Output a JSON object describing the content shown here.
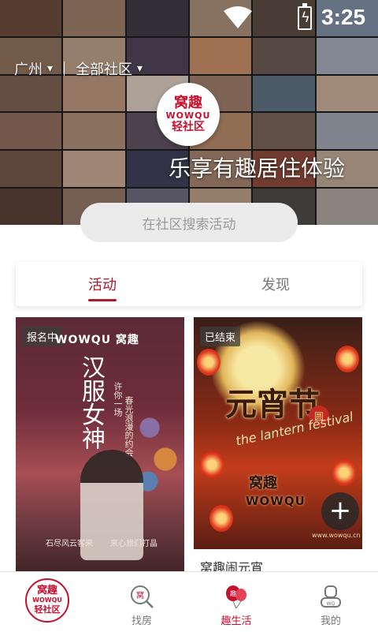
{
  "status_bar": {
    "time": "3:25"
  },
  "header": {
    "city": "广州",
    "community": "全部社区",
    "logo": {
      "line1": "窝趣",
      "line2": "WOWQU",
      "line3": "轻社区"
    },
    "slogan": "乐享有趣居住体验"
  },
  "search": {
    "placeholder": "在社区搜索活动"
  },
  "tabs": [
    {
      "label": "活动",
      "active": true
    },
    {
      "label": "发现",
      "active": false
    }
  ],
  "cards": [
    {
      "badge": "报名中",
      "poster_brand": "WOWQU 窝趣",
      "poster_title": "汉服女神",
      "poster_sub1": "许你一场",
      "poster_sub2": "春光浪漫的约会",
      "poster_foot1": "石尽风云客来",
      "poster_foot2": "来心旅们打晶"
    },
    {
      "badge": "已结束",
      "poster_title": "元宵节",
      "poster_en": "the lantern festival",
      "poster_circle": "圆",
      "poster_brand": "窝趣",
      "poster_wowqu": "WOWQU",
      "poster_url": "www.wowqu.cn",
      "title": "窝趣闹元宵"
    }
  ],
  "bottom_nav": [
    {
      "label": "",
      "logo_top": "窝趣",
      "logo_mid": "WOWQU",
      "logo_bottom": "轻社区"
    },
    {
      "label": "找房"
    },
    {
      "label": "趣生活",
      "active": true
    },
    {
      "label": "我的"
    }
  ],
  "colors": {
    "accent": "#c8102e",
    "tab_active": "#b0182b"
  }
}
